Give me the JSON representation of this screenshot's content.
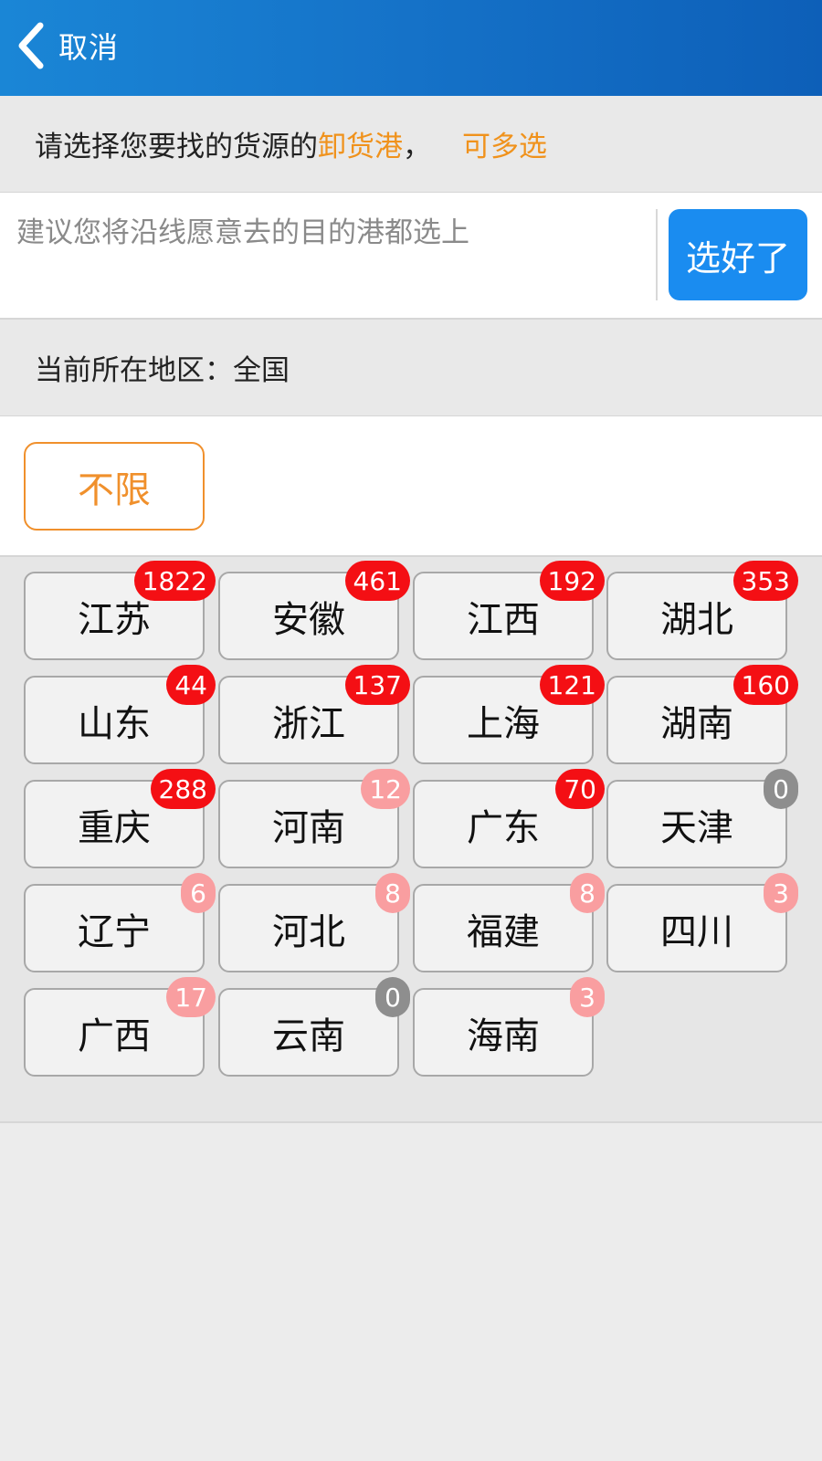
{
  "nav": {
    "back_label": "取消"
  },
  "hint": {
    "prefix": "请选择您要找的货源的",
    "highlight": "卸货港",
    "separator": "，",
    "multi": "可多选"
  },
  "input": {
    "placeholder": "建议您将沿线愿意去的目的港都选上",
    "value": ""
  },
  "done_button": "选好了",
  "region": {
    "label": "当前所在地区：",
    "value": "全国"
  },
  "unlimited_button": "不限",
  "provinces": [
    {
      "name": "江苏",
      "count": "1822"
    },
    {
      "name": "安徽",
      "count": "461"
    },
    {
      "name": "江西",
      "count": "192"
    },
    {
      "name": "湖北",
      "count": "353"
    },
    {
      "name": "山东",
      "count": "44"
    },
    {
      "name": "浙江",
      "count": "137"
    },
    {
      "name": "上海",
      "count": "121"
    },
    {
      "name": "湖南",
      "count": "160"
    },
    {
      "name": "重庆",
      "count": "288"
    },
    {
      "name": "河南",
      "count": "12"
    },
    {
      "name": "广东",
      "count": "70"
    },
    {
      "name": "天津",
      "count": "0"
    },
    {
      "name": "辽宁",
      "count": "6"
    },
    {
      "name": "河北",
      "count": "8"
    },
    {
      "name": "福建",
      "count": "8"
    },
    {
      "name": "四川",
      "count": "3"
    },
    {
      "name": "广西",
      "count": "17"
    },
    {
      "name": "云南",
      "count": "0"
    },
    {
      "name": "海南",
      "count": "3"
    }
  ],
  "colors": {
    "nav_bar": "#1572c8",
    "accent_orange": "#f0921c",
    "button_blue": "#1a8cf0",
    "badge_high": "#f40f14",
    "badge_low": "#f99ea0",
    "badge_zero": "#8e8e8e"
  }
}
